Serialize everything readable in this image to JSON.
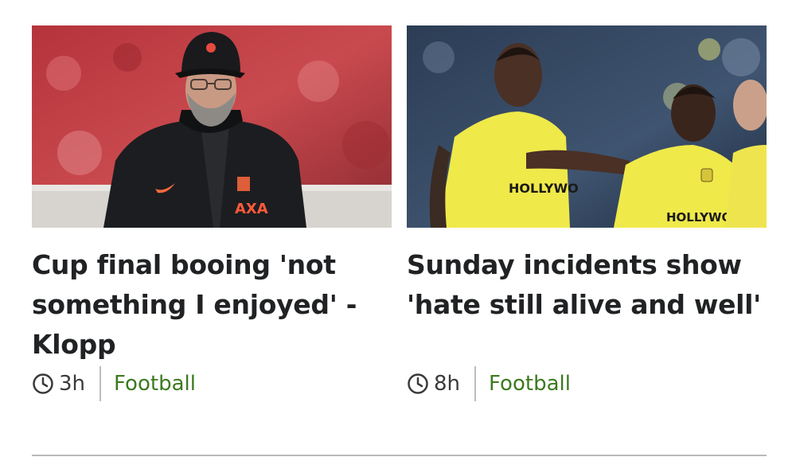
{
  "stories": [
    {
      "headline": "Cup final booing 'not something I enjoyed' - Klopp",
      "time": "3h",
      "topic": "Football",
      "image_alt": "Jurgen Klopp in Liverpool jacket and cap",
      "shirt_text": "AXA"
    },
    {
      "headline": "Sunday incidents show 'hate still alive and well'",
      "time": "8h",
      "topic": "Football",
      "image_alt": "Brentford players in yellow kit",
      "shirt_text_a": "HOLLYWO",
      "shirt_text_b": "HOLLYWOOD"
    }
  ],
  "colors": {
    "topic": "#3c7a1f",
    "text": "#202224",
    "divider": "#b9b9b9"
  },
  "icons": {
    "time": "clock-icon"
  }
}
